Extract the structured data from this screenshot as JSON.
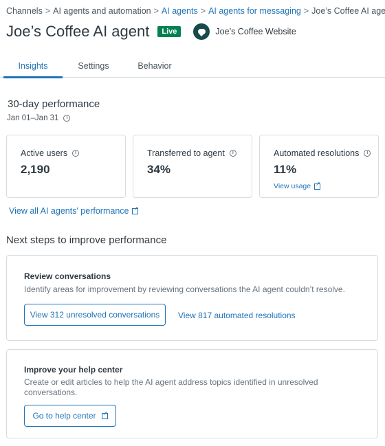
{
  "breadcrumb": {
    "items": [
      "Channels",
      "AI agents and automation",
      "AI agents",
      "AI agents for messaging",
      "Joe’s Coffee AI agent"
    ],
    "separator": ">"
  },
  "header": {
    "title": "Joe’s Coffee AI agent",
    "status_badge": "Live",
    "channel_name": "Joe’s Coffee Website",
    "channel_icon": "chat-bubble-icon"
  },
  "tabs": [
    {
      "label": "Insights",
      "active": true
    },
    {
      "label": "Settings",
      "active": false
    },
    {
      "label": "Behavior",
      "active": false
    }
  ],
  "performance": {
    "title": "30-day performance",
    "date_range": "Jan 01–Jan 31",
    "cards": [
      {
        "label": "Active users",
        "value": "2,190",
        "link": ""
      },
      {
        "label": "Transferred to agent",
        "value": "34%",
        "link": ""
      },
      {
        "label": "Automated resolutions",
        "value": "11%",
        "link": "View usage"
      }
    ],
    "view_all_link": "View all AI agents' performance"
  },
  "next_steps": {
    "title": "Next steps to improve performance",
    "review": {
      "title": "Review conversations",
      "description": "Identify areas for improvement by reviewing conversations the AI agent couldn’t resolve.",
      "primary_button": "View 312 unresolved conversations",
      "secondary_link": "View 817 automated resolutions"
    },
    "help_center": {
      "title": "Improve your help center",
      "description": "Create or edit articles to help the AI agent address topics identified in unresolved conversations.",
      "button": "Go to help center"
    }
  },
  "colors": {
    "accent": "#1f73b7",
    "live_badge": "#038153",
    "channel_icon_bg": "#17494d",
    "border": "#d8dcde"
  }
}
